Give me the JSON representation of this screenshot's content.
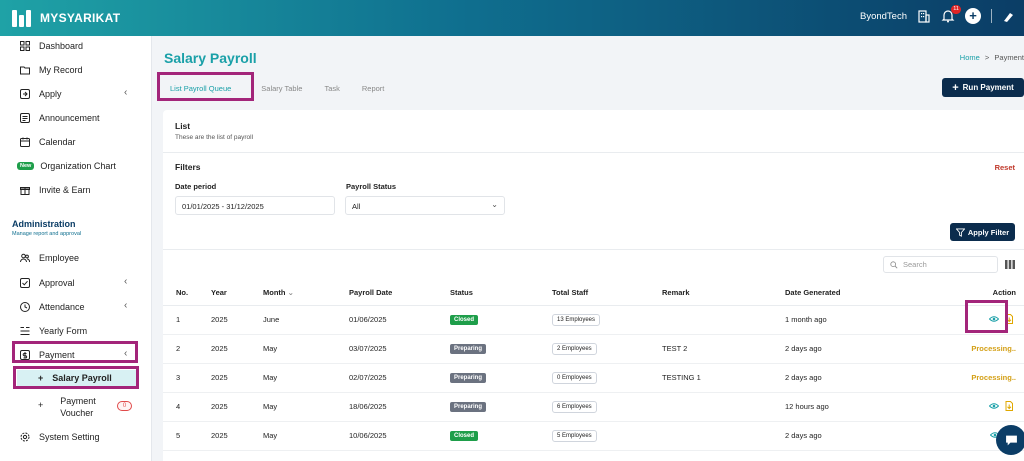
{
  "app": {
    "name": "MYSYARIKAT",
    "company": "ByondTech",
    "notification_count": "11"
  },
  "sidebar": {
    "items": [
      {
        "label": "Dashboard"
      },
      {
        "label": "My Record"
      },
      {
        "label": "Apply"
      },
      {
        "label": "Announcement"
      },
      {
        "label": "Calendar"
      },
      {
        "label": "Organization Chart",
        "badge": "New"
      },
      {
        "label": "Invite & Earn"
      }
    ],
    "section": {
      "title": "Administration",
      "subtitle": "Manage report and approval"
    },
    "admin_items": [
      {
        "label": "Employee"
      },
      {
        "label": "Approval"
      },
      {
        "label": "Attendance"
      },
      {
        "label": "Yearly Form"
      },
      {
        "label": "Payment"
      }
    ],
    "sub_items": [
      {
        "label": "Salary Payroll"
      },
      {
        "label": "Payment Voucher",
        "label_line1": "Payment",
        "label_line2": "Voucher",
        "badge": "0"
      }
    ],
    "footer_item": {
      "label": "System Setting"
    }
  },
  "page": {
    "title": "Salary Payroll",
    "breadcrumb": {
      "home": "Home",
      "sep": ">",
      "current": "Payment"
    },
    "tabs": [
      "List Payroll Queue",
      "Salary Table",
      "Task",
      "Report"
    ],
    "run_button": "Run Payment"
  },
  "card": {
    "title": "List",
    "subtitle": "These are the list of payroll",
    "filters_title": "Filters",
    "reset": "Reset",
    "date_label": "Date period",
    "date_value": "01/01/2025 - 31/12/2025",
    "status_label": "Payroll Status",
    "status_value": "All",
    "apply_button": "Apply Filter",
    "search_placeholder": "Search"
  },
  "table": {
    "headers": [
      "No.",
      "Year",
      "Month",
      "Payroll Date",
      "Status",
      "Total Staff",
      "Remark",
      "Date Generated",
      "Action"
    ],
    "rows": [
      {
        "no": "1",
        "year": "2025",
        "month": "June",
        "date": "01/06/2025",
        "status": "Closed",
        "staff": "13 Employees",
        "remark": "",
        "generated": "1 month ago",
        "action": "icons"
      },
      {
        "no": "2",
        "year": "2025",
        "month": "May",
        "date": "03/07/2025",
        "status": "Preparing",
        "staff": "2 Employees",
        "remark": "TEST 2",
        "generated": "2 days ago",
        "action": "Processing.."
      },
      {
        "no": "3",
        "year": "2025",
        "month": "May",
        "date": "02/07/2025",
        "status": "Preparing",
        "staff": "0 Employees",
        "remark": "TESTING 1",
        "generated": "2 days ago",
        "action": "Processing.."
      },
      {
        "no": "4",
        "year": "2025",
        "month": "May",
        "date": "18/06/2025",
        "status": "Preparing",
        "staff": "6 Employees",
        "remark": "",
        "generated": "12 hours ago",
        "action": "icons"
      },
      {
        "no": "5",
        "year": "2025",
        "month": "May",
        "date": "10/06/2025",
        "status": "Closed",
        "staff": "5 Employees",
        "remark": "",
        "generated": "2 days ago",
        "action": "icons"
      }
    ]
  },
  "colors": {
    "accent": "#1aa0a8",
    "navy": "#0b2c4d",
    "highlight": "#a3257a",
    "closed": "#1e9e4a",
    "preparing": "#6b7280",
    "processing": "#d4a017"
  }
}
